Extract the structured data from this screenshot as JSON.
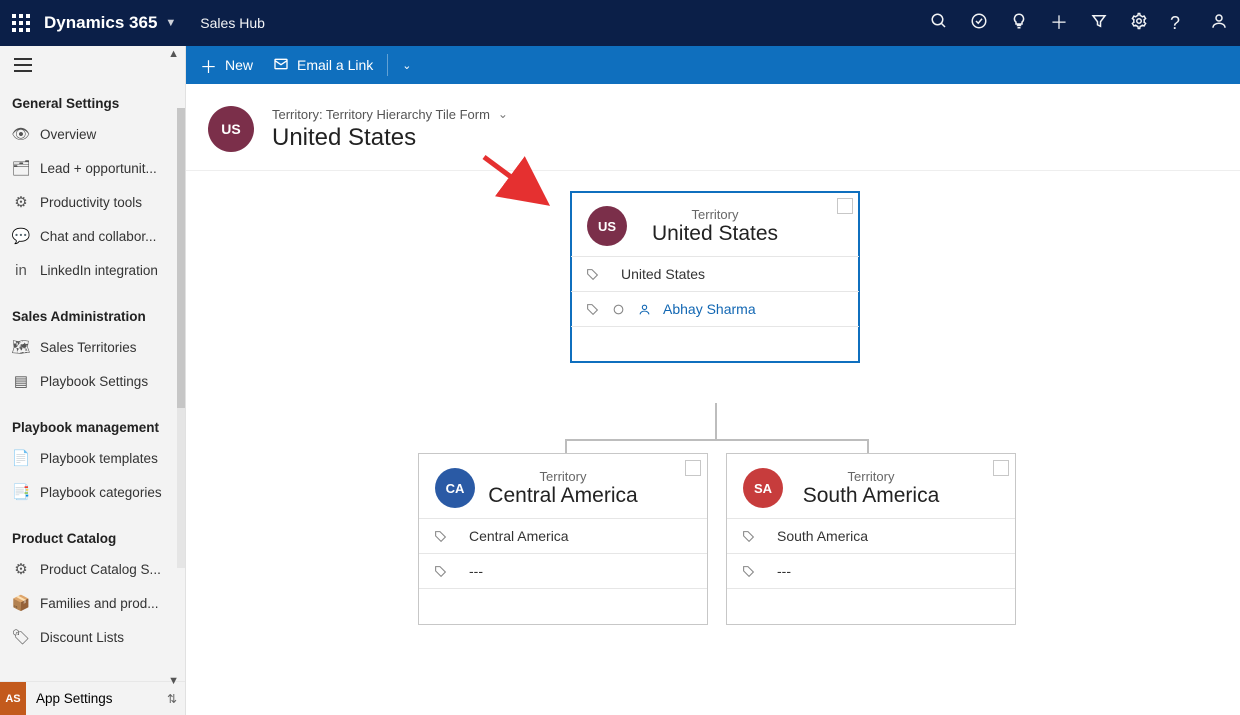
{
  "header": {
    "app_name": "Dynamics 365",
    "hub_name": "Sales Hub"
  },
  "commandbar": {
    "new_label": "New",
    "email_link_label": "Email a Link"
  },
  "record": {
    "avatar_initials": "US",
    "avatar_color": "bg-maroon",
    "form_label": "Territory: Territory Hierarchy Tile Form",
    "title": "United States"
  },
  "sidebar": {
    "sections": [
      {
        "title": "General Settings",
        "items": [
          {
            "icon": "eye",
            "label": "Overview"
          },
          {
            "icon": "lead",
            "label": "Lead + opportunit..."
          },
          {
            "icon": "gear",
            "label": "Productivity tools"
          },
          {
            "icon": "chat",
            "label": "Chat and collabor..."
          },
          {
            "icon": "linkedin",
            "label": "LinkedIn integration"
          }
        ]
      },
      {
        "title": "Sales Administration",
        "items": [
          {
            "icon": "map",
            "label": "Sales Territories"
          },
          {
            "icon": "playbook",
            "label": "Playbook Settings"
          }
        ]
      },
      {
        "title": "Playbook management",
        "items": [
          {
            "icon": "template",
            "label": "Playbook templates"
          },
          {
            "icon": "category",
            "label": "Playbook categories"
          }
        ]
      },
      {
        "title": "Product Catalog",
        "items": [
          {
            "icon": "catalog",
            "label": "Product Catalog S..."
          },
          {
            "icon": "box",
            "label": "Families and prod..."
          },
          {
            "icon": "tag",
            "label": "Discount Lists"
          }
        ]
      }
    ],
    "footer": {
      "avatar": "AS",
      "label": "App Settings"
    }
  },
  "hierarchy": {
    "root": {
      "initials": "US",
      "color": "bg-maroon",
      "type": "Territory",
      "name": "United States",
      "field1": "United States",
      "owner": "Abhay Sharma"
    },
    "children": [
      {
        "initials": "CA",
        "color": "bg-blue",
        "type": "Territory",
        "name": "Central America",
        "field1": "Central America",
        "owner": "---"
      },
      {
        "initials": "SA",
        "color": "bg-red",
        "type": "Territory",
        "name": "South America",
        "field1": "South America",
        "owner": "---"
      }
    ]
  }
}
